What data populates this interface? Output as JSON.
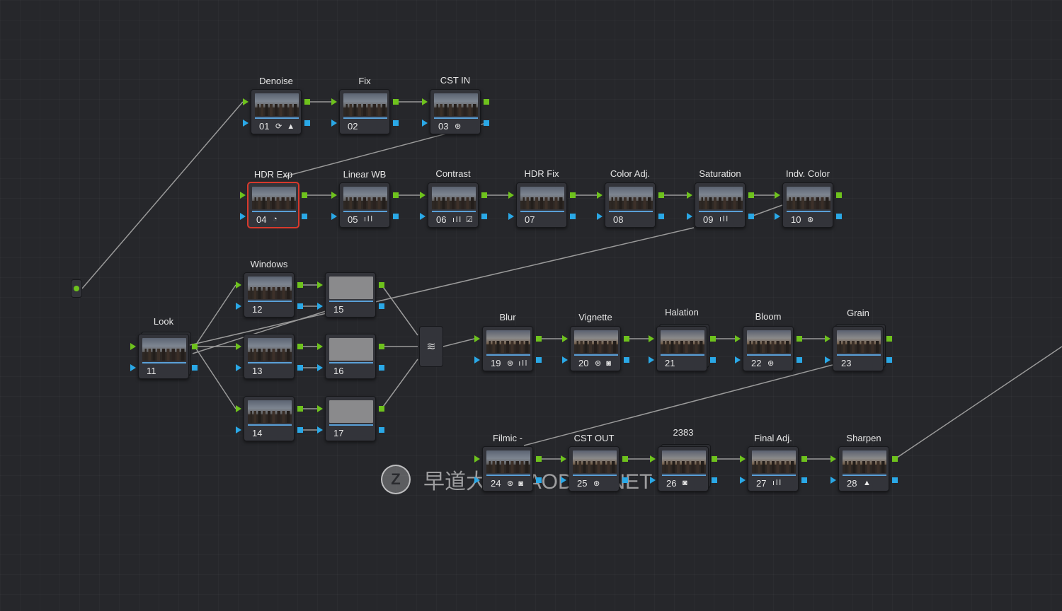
{
  "nodes": [
    {
      "id": "01",
      "label": "Denoise",
      "icons": "⟳ ▲"
    },
    {
      "id": "02",
      "label": "Fix",
      "icons": ""
    },
    {
      "id": "03",
      "label": "CST IN",
      "icons": "⊛"
    },
    {
      "id": "04",
      "label": "HDR Exp",
      "icons": "◔"
    },
    {
      "id": "05",
      "label": "Linear WB",
      "icons": "ıll"
    },
    {
      "id": "06",
      "label": "Contrast",
      "icons": "ıll ☑"
    },
    {
      "id": "07",
      "label": "HDR Fix",
      "icons": ""
    },
    {
      "id": "08",
      "label": "Color Adj.",
      "icons": ""
    },
    {
      "id": "09",
      "label": "Saturation",
      "icons": "ıll"
    },
    {
      "id": "10",
      "label": "Indv. Color",
      "icons": "⊛"
    },
    {
      "id": "11",
      "label": "Look",
      "icons": ""
    },
    {
      "id": "12",
      "label": "Windows",
      "icons": ""
    },
    {
      "id": "13",
      "label": "",
      "icons": ""
    },
    {
      "id": "14",
      "label": "",
      "icons": ""
    },
    {
      "id": "15",
      "label": "",
      "icons": ""
    },
    {
      "id": "16",
      "label": "",
      "icons": ""
    },
    {
      "id": "17",
      "label": "",
      "icons": ""
    },
    {
      "id": "19",
      "label": "Blur",
      "icons": "⊛ ıll"
    },
    {
      "id": "20",
      "label": "Vignette",
      "icons": "⊛ ◙"
    },
    {
      "id": "21",
      "label": "Halation",
      "icons": ""
    },
    {
      "id": "22",
      "label": "Bloom",
      "icons": "⊛"
    },
    {
      "id": "23",
      "label": "Grain",
      "icons": ""
    },
    {
      "id": "24",
      "label": "Filmic -",
      "icons": "⊛ ◙"
    },
    {
      "id": "25",
      "label": "CST OUT",
      "icons": "⊛"
    },
    {
      "id": "26",
      "label": "2383",
      "icons": "◙"
    },
    {
      "id": "27",
      "label": "Final Adj.",
      "icons": "ıll"
    },
    {
      "id": "28",
      "label": "Sharpen",
      "icons": "▲"
    }
  ],
  "layer_mixer_icon": "layers-icon",
  "watermark": {
    "logo": "Z",
    "text": "早道大咖 ZAODAO.NET"
  },
  "colors": {
    "rgb_port": "#6ec21d",
    "alpha_port": "#2aa8e6",
    "selected": "#d8392c",
    "wire": "#9a9a9a"
  }
}
